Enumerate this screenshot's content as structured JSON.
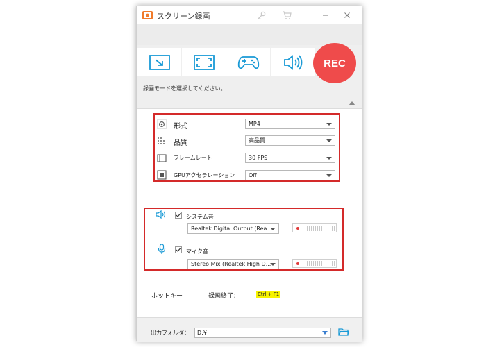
{
  "window": {
    "title": "スクリーン録画",
    "icons": [
      "app-icon",
      "key-icon",
      "cart-icon",
      "minimize-icon",
      "close-icon"
    ]
  },
  "modes": {
    "buttons": [
      {
        "name": "region",
        "icon": "region-capture-icon"
      },
      {
        "name": "fullscreen",
        "icon": "fullscreen-icon"
      },
      {
        "name": "game",
        "icon": "gamepad-icon"
      },
      {
        "name": "audio",
        "icon": "speaker-icon"
      }
    ],
    "rec_label": "REC",
    "hint": "録画モードを選択してください。"
  },
  "settings": {
    "format_label": "形式",
    "format_value": "MP4",
    "quality_label": "品質",
    "quality_value": "高品質",
    "framerate_label": "フレームレート",
    "framerate_value": "30 FPS",
    "gpu_label": "GPUアクセラレーション",
    "gpu_value": "Off"
  },
  "audio": {
    "system_label": "システム音",
    "system_device": "Realtek Digital Output (Rea...",
    "system_checked": true,
    "mic_label": "マイク音",
    "mic_device": "Stereo Mix (Realtek High D...",
    "mic_checked": true
  },
  "hotkey": {
    "label": "ホットキー",
    "stop_label": "録画終了：",
    "stop_key": "Ctrl + F1"
  },
  "output": {
    "label": "出力フォルダ：",
    "path": "D:¥"
  },
  "colors": {
    "accent": "#1a9ad6",
    "rec": "#ef4b4b",
    "highlight_box": "#d42a2a",
    "hotkey_bg": "#f7f300"
  }
}
